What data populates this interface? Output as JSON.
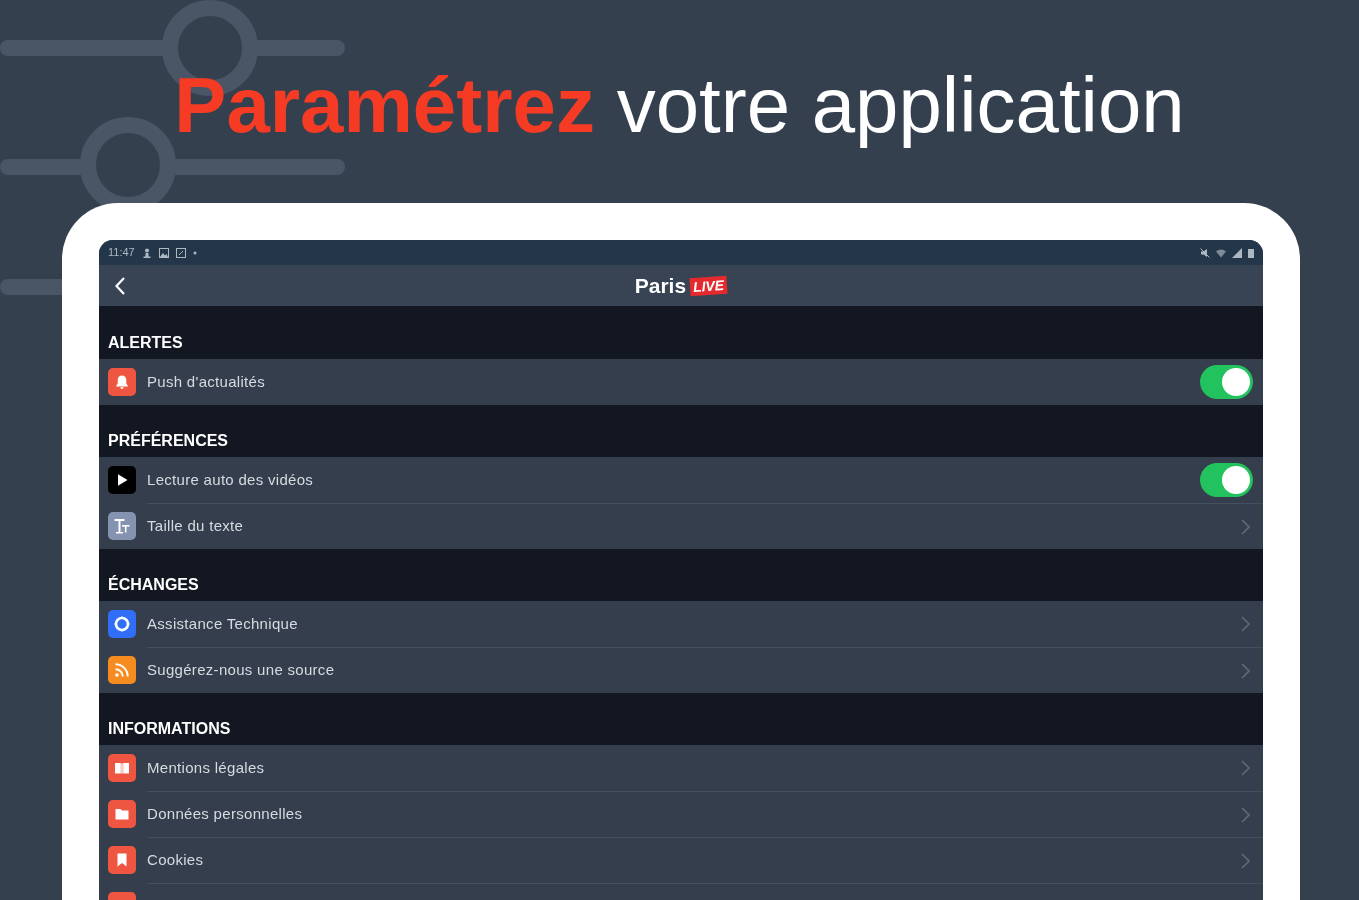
{
  "headline": {
    "highlight": "Paramétrez",
    "rest": "votre application"
  },
  "status_bar": {
    "time": "11:47"
  },
  "app_bar": {
    "logo": "Paris",
    "logo_badge": "LIVE"
  },
  "sections": [
    {
      "title": "ALERTES",
      "items": [
        {
          "label": "Push d'actualités",
          "kind": "toggle",
          "on": true,
          "color": "#ef5641"
        }
      ]
    },
    {
      "title": "PRÉFÉRENCES",
      "items": [
        {
          "label": "Lecture auto des vidéos",
          "kind": "toggle",
          "on": true,
          "color": "#000000"
        },
        {
          "label": "Taille du texte",
          "kind": "link",
          "color": "#8393b0"
        }
      ]
    },
    {
      "title": "ÉCHANGES",
      "items": [
        {
          "label": "Assistance Technique",
          "kind": "link",
          "color": "#2f6ef5"
        },
        {
          "label": "Suggérez-nous une source",
          "kind": "link",
          "color": "#f68b1f"
        }
      ]
    },
    {
      "title": "INFORMATIONS",
      "items": [
        {
          "label": "Mentions légales",
          "kind": "link",
          "color": "#ef5641"
        },
        {
          "label": "Données personnelles",
          "kind": "link",
          "color": "#ef5641"
        },
        {
          "label": "Cookies",
          "kind": "link",
          "color": "#ef5641"
        },
        {
          "color": "#ef5641"
        }
      ]
    }
  ]
}
